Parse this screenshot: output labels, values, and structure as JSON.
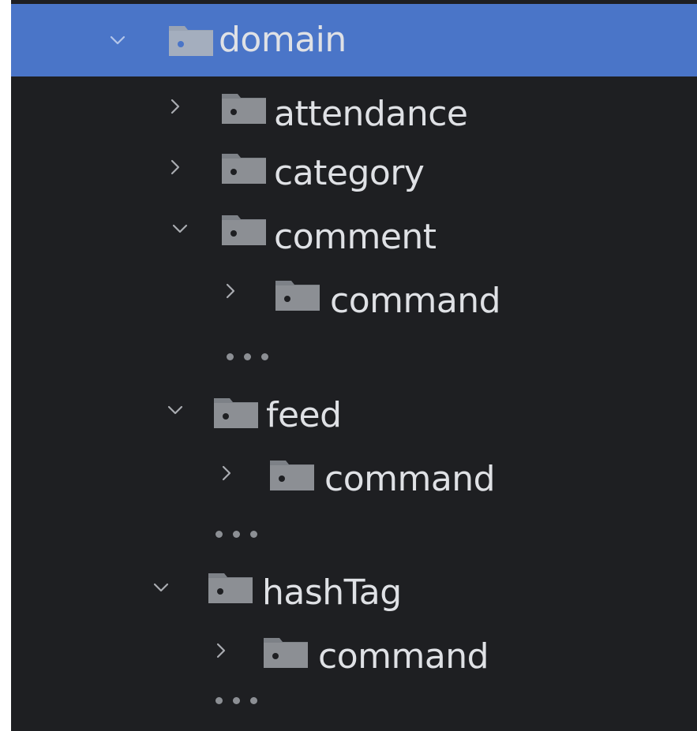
{
  "tree": [
    {
      "name": "domain",
      "expanded": true,
      "selected": true
    },
    {
      "name": "attendance",
      "expanded": false
    },
    {
      "name": "category",
      "expanded": false
    },
    {
      "name": "comment",
      "expanded": true
    },
    {
      "name": "command",
      "expanded": false
    },
    {
      "name": "feed",
      "expanded": true
    },
    {
      "name": "command",
      "expanded": false
    },
    {
      "name": "hashTag",
      "expanded": true
    },
    {
      "name": "command",
      "expanded": false
    }
  ],
  "colors": {
    "background": "#1e1f22",
    "selection": "#4a75c8",
    "text": "#dfe1e5",
    "folder_icon": "#8c8f94",
    "chevron": "#a9acb1"
  },
  "icons": {
    "expanded": "chevron-down-icon",
    "collapsed": "chevron-right-icon",
    "folder": "package-folder-icon",
    "more": "ellipsis-icon"
  }
}
